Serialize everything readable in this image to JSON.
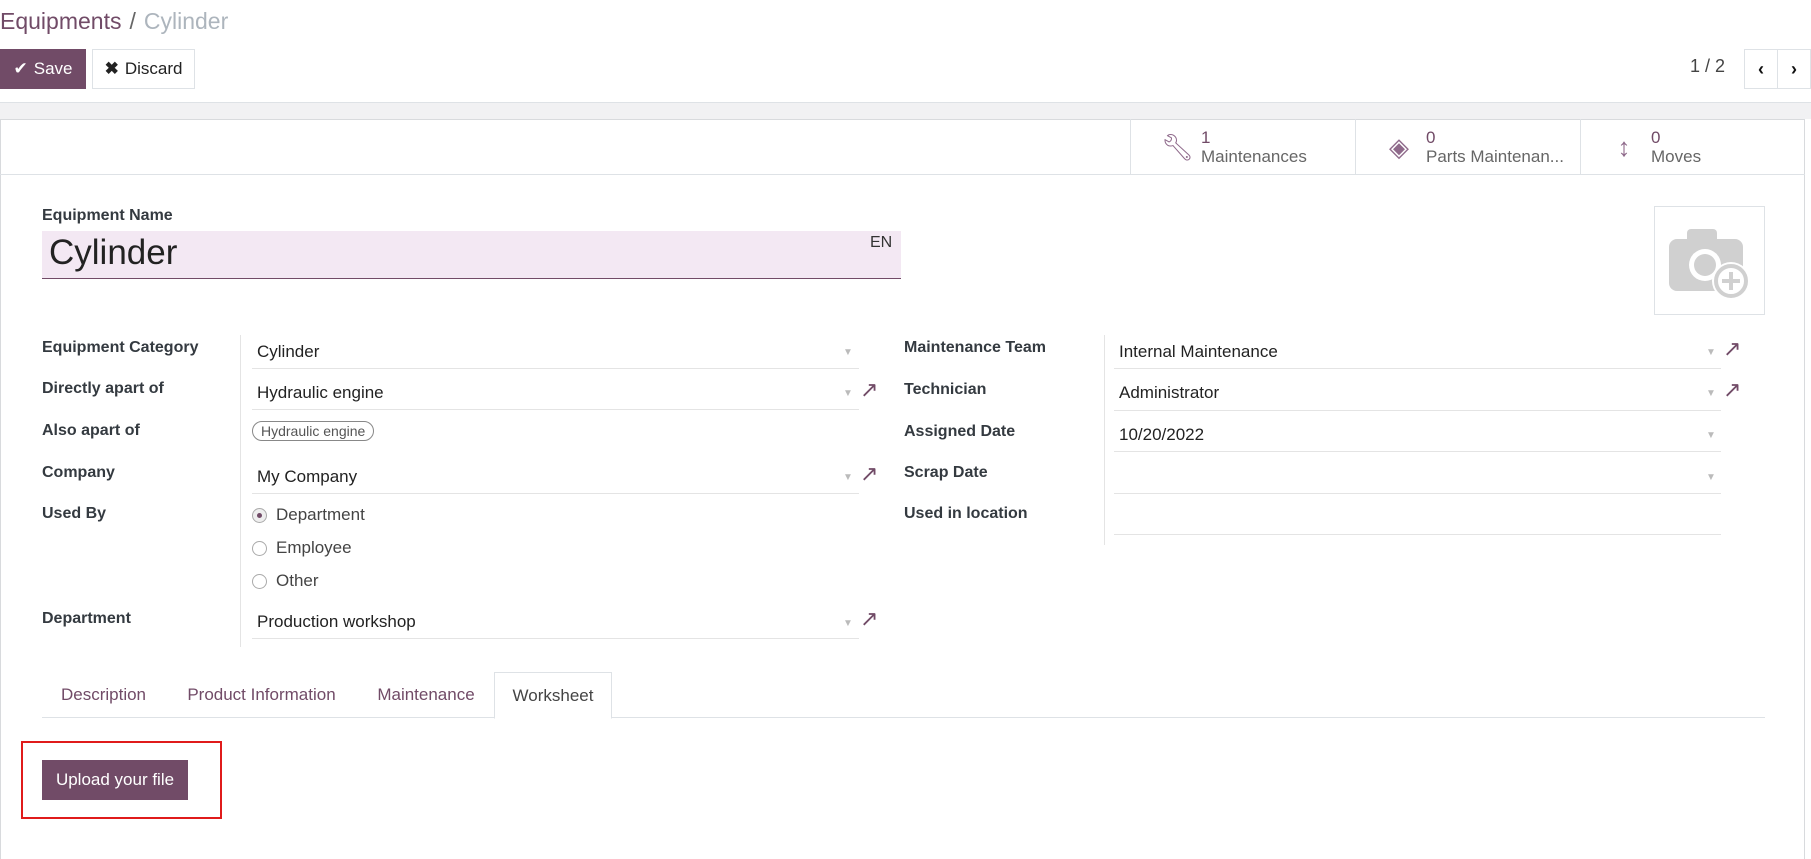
{
  "breadcrumb": {
    "parent": "Equipments",
    "separator": "/",
    "current": "Cylinder"
  },
  "toolbar": {
    "save_label": "Save",
    "discard_label": "Discard"
  },
  "pager": {
    "value": "1 / 2"
  },
  "stats": [
    {
      "icon": "wrench-icon",
      "count": "1",
      "label": "Maintenances"
    },
    {
      "icon": "ticket-icon",
      "count": "0",
      "label": "Parts Maintenan..."
    },
    {
      "icon": "arrows-v-icon",
      "count": "0",
      "label": "Moves"
    }
  ],
  "name": {
    "label": "Equipment Name",
    "value": "Cylinder",
    "lang": "EN"
  },
  "left_fields": {
    "category": {
      "label": "Equipment Category",
      "value": "Cylinder"
    },
    "direct_parent": {
      "label": "Directly apart of",
      "value": "Hydraulic engine"
    },
    "also_parent": {
      "label": "Also apart of",
      "tag": "Hydraulic engine"
    },
    "company": {
      "label": "Company",
      "value": "My Company"
    },
    "used_by": {
      "label": "Used By",
      "options": [
        "Department",
        "Employee",
        "Other"
      ],
      "selected": "Department"
    },
    "department": {
      "label": "Department",
      "value": "Production workshop"
    }
  },
  "right_fields": {
    "team": {
      "label": "Maintenance Team",
      "value": "Internal Maintenance"
    },
    "technician": {
      "label": "Technician",
      "value": "Administrator"
    },
    "assigned_date": {
      "label": "Assigned Date",
      "value": "10/20/2022"
    },
    "scrap_date": {
      "label": "Scrap Date",
      "value": ""
    },
    "location": {
      "label": "Used in location",
      "value": ""
    }
  },
  "tabs": [
    {
      "label": "Description"
    },
    {
      "label": "Product Information"
    },
    {
      "label": "Maintenance"
    },
    {
      "label": "Worksheet",
      "active": true
    }
  ],
  "worksheet": {
    "upload_label": "Upload your file"
  },
  "colors": {
    "brand": "#714B67",
    "highlight": "#e01b1b"
  }
}
